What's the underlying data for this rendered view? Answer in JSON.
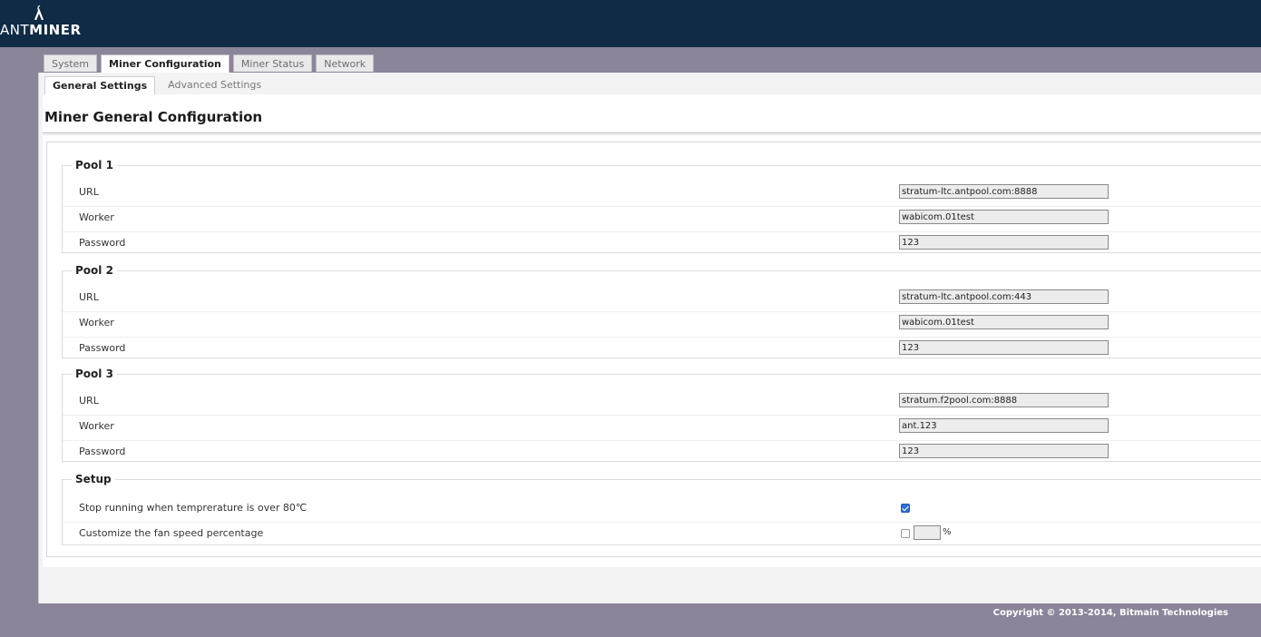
{
  "brand": {
    "logo_text_light": "ANT",
    "logo_text_bold": "MINER"
  },
  "tabs": [
    {
      "label": "System",
      "active": false
    },
    {
      "label": "Miner Configuration",
      "active": true
    },
    {
      "label": "Miner Status",
      "active": false
    },
    {
      "label": "Network",
      "active": false
    }
  ],
  "subtabs": [
    {
      "label": "General Settings",
      "active": true
    },
    {
      "label": "Advanced Settings",
      "active": false
    }
  ],
  "page_title": "Miner General Configuration",
  "pools": [
    {
      "legend": "Pool 1",
      "url_label": "URL",
      "url": "stratum-ltc.antpool.com:8888",
      "worker_label": "Worker",
      "worker": "wabicom.01test",
      "password_label": "Password",
      "password": "123"
    },
    {
      "legend": "Pool 2",
      "url_label": "URL",
      "url": "stratum-ltc.antpool.com:443",
      "worker_label": "Worker",
      "worker": "wabicom.01test",
      "password_label": "Password",
      "password": "123"
    },
    {
      "legend": "Pool 3",
      "url_label": "URL",
      "url": "stratum.f2pool.com:8888",
      "worker_label": "Worker",
      "worker": "ant.123",
      "password_label": "Password",
      "password": "123"
    }
  ],
  "setup": {
    "legend": "Setup",
    "temp_label": "Stop running when temprerature is over 80℃",
    "temp_checked": true,
    "fan_label": "Customize the fan speed percentage",
    "fan_checked": false,
    "fan_value": "",
    "fan_unit": "%"
  },
  "footer": {
    "copyright": "Copyright © 2013-2014, Bitmain Technologies"
  },
  "colors": {
    "header_bg": "#0f2b45",
    "page_bg": "#8c8499",
    "checkbox_on": "#2d6ed8"
  }
}
